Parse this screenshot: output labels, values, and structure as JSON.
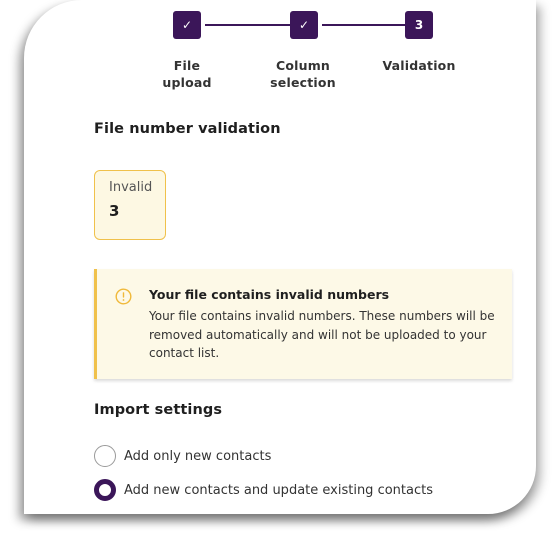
{
  "stepper": {
    "steps": [
      {
        "label_line1": "File",
        "label_line2": "upload",
        "status": "complete",
        "mark": "✓"
      },
      {
        "label_line1": "Column",
        "label_line2": "selection",
        "status": "complete",
        "mark": "✓"
      },
      {
        "label_line1": "Validation",
        "label_line2": "",
        "status": "current",
        "mark": "3"
      }
    ],
    "accent": "#3b1659"
  },
  "validation": {
    "title": "File number validation",
    "invalid_label": "Invalid",
    "invalid_count": "3"
  },
  "alert": {
    "icon": "warning-circle-icon",
    "title": "Your file contains invalid numbers",
    "body": "Your file contains invalid numbers. These numbers will be removed automatically and will not be uploaded to your contact list.",
    "color": "#f0c14b"
  },
  "import_settings": {
    "title": "Import settings",
    "options": [
      {
        "label": "Add only new contacts",
        "selected": false
      },
      {
        "label": "Add new contacts and update existing contacts",
        "selected": true
      }
    ]
  }
}
